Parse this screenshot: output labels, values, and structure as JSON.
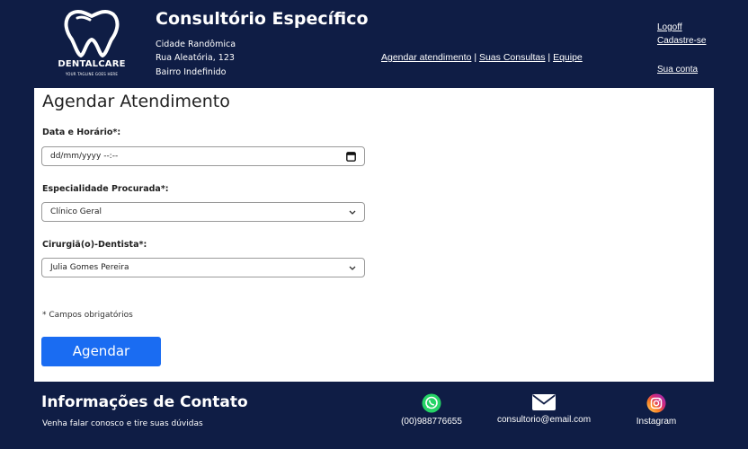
{
  "header": {
    "logo": {
      "brand": "DENTALCARE",
      "tagline": "YOUR TAGLINE GOES HERE"
    },
    "clinic_name": "Consultório Específico",
    "address": [
      "Cidade Randômica",
      "Rua Aleatória, 123",
      "Bairro Indefinido"
    ],
    "nav": {
      "schedule": "Agendar atendimento",
      "sep1": " | ",
      "appointments": "Suas Consultas",
      "sep2": " | ",
      "team": "Equipe"
    },
    "account": {
      "logoff": "Logoff",
      "register": "Cadastre-se",
      "my_account": "Sua conta"
    }
  },
  "form": {
    "title": "Agendar Atendimento",
    "datetime": {
      "label": "Data e Horário*:",
      "value": "dd/mm/yyyy --:--"
    },
    "specialty": {
      "label": "Especialidade Procurada*:",
      "selected": "Clínico Geral"
    },
    "dentist": {
      "label": "Cirurgiã(o)-Dentista*:",
      "selected": "Julia Gomes Pereira"
    },
    "required_note": "* Campos obrigatórios",
    "submit_label": "Agendar"
  },
  "footer": {
    "title": "Informações de Contato",
    "subtitle": "Venha falar conosco e tire suas dúvidas",
    "contacts": {
      "whatsapp": {
        "text": "(00)988776655",
        "icon": "whatsapp-icon"
      },
      "email": {
        "text": "consultorio@email.com",
        "icon": "envelope-icon"
      },
      "instagram": {
        "text": "Instagram",
        "icon": "instagram-icon"
      }
    }
  },
  "colors": {
    "background": "#0f1d45",
    "card": "#ffffff",
    "button": "#1a6cf2",
    "whatsapp": "#25d366"
  }
}
